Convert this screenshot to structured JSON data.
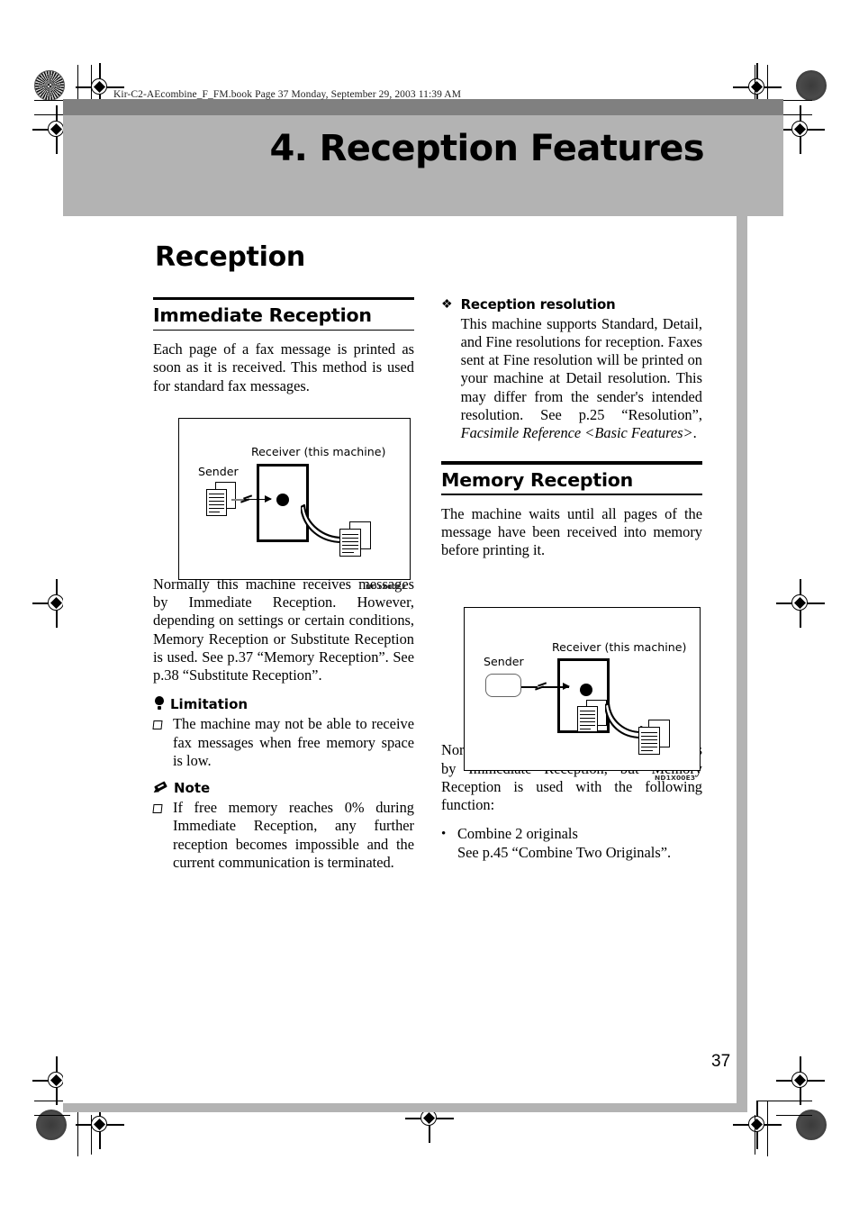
{
  "page": {
    "file_header": "Kir-C2-AEcombine_F_FM.book  Page 37  Monday, September 29, 2003  11:39 AM",
    "chapter_title": "4. Reception Features",
    "section_title": "Reception",
    "page_number": "37"
  },
  "left_column": {
    "heading": "Immediate Reception",
    "intro": "Each page of a fax message is printed as soon as it is received. This method is used for standard fax messages.",
    "figure": {
      "id": "ND1X00E2",
      "sender_label": "Sender",
      "receiver_label": "Receiver (this machine)"
    },
    "after_figure": "Normally this machine receives messages by Immediate Reception. However, depending on settings or certain conditions, Memory Reception or Substitute Reception is used. See p.37 “Memory Reception”. See p.38 “Substitute Reception”.",
    "limitation": {
      "heading": "Limitation",
      "items": [
        "The machine may not be able to receive fax messages when free memory space is low."
      ]
    },
    "note": {
      "heading": "Note",
      "items": [
        "If free memory reaches 0% during Immediate Reception, any further reception becomes impossible and the current communication is terminated."
      ]
    }
  },
  "right_column": {
    "resolution_block": {
      "bullet": "❖",
      "heading": "Reception resolution",
      "text_part1": "This machine supports Standard, Detail, and Fine resolutions for reception. Faxes sent at Fine resolution will be printed on your machine at Detail resolution. This may differ from the sender's intended resolution. See p.25 “Resolution”, ",
      "text_italic": "Facsimile Reference <Basic Features>",
      "text_part2": "."
    },
    "heading": "Memory Reception",
    "intro": "The machine waits until all pages of the message have been received into memory before printing it.",
    "figure": {
      "id": "ND1X00E3",
      "sender_label": "Sender",
      "receiver_label": "Receiver (this machine)"
    },
    "after_figure": "Normally this machine receives messages by Immediate Reception, but Memory Reception is used with the following function:",
    "bullet_list": [
      {
        "bullet": "•",
        "line1": "Combine 2 originals",
        "line2": "See p.45 “Combine Two Originals”."
      }
    ]
  },
  "colors": {
    "band_dark": "#808080",
    "band_light": "#b3b3b3",
    "text": "#000000",
    "paper": "#ffffff"
  }
}
